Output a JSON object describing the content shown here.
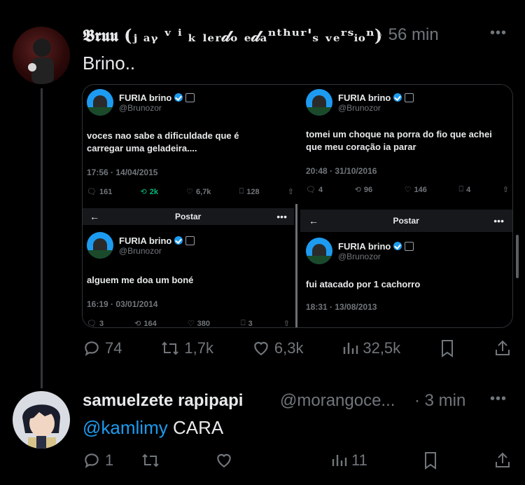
{
  "post1": {
    "author_name": "𝕭𝖗𝖚𝖚 (ⱼ ₐᵧ ᵛ ⁱ ₖ ₗₑᵣ𝒹ₒ ₑ𝒹ₐⁿᵗʰᵘʳ'ₛ ᵥₑʳˢᵢₒⁿ)",
    "time": "· 56 min",
    "text": "Brino..",
    "stats": {
      "replies": "74",
      "retweets": "1,7k",
      "likes": "6,3k",
      "views": "32,5k"
    }
  },
  "media": {
    "cells": [
      {
        "name": "FURIA brino",
        "handle": "@Brunozor",
        "text": "voces nao sabe a dificuldade que é carregar uma geladeira....",
        "date": "17:56 · 14/04/2015",
        "replies": "161",
        "retweets": "2k",
        "likes": "6,7k",
        "bookmarks": "128"
      },
      {
        "name": "FURIA brino",
        "handle": "@Brunozor",
        "text": "tomei um choque na porra do fio que achei que meu coração ia parar",
        "date": "20:48 · 31/10/2016",
        "replies": "4",
        "retweets": "96",
        "likes": "146",
        "bookmarks": "4"
      },
      {
        "bar_title": "Postar",
        "name": "FURIA brino",
        "handle": "@Brunozor",
        "text": "alguem me doa um boné",
        "date": "16:19 · 03/01/2014",
        "replies": "3",
        "retweets": "164",
        "likes": "380",
        "bookmarks": "3"
      },
      {
        "bar_title": "Postar",
        "name": "FURIA brino",
        "handle": "@Brunozor",
        "text": "fui atacado por 1 cachorro",
        "date": "18:31 · 13/08/2013"
      }
    ]
  },
  "post2": {
    "author_name": "samuelzete rapipapi",
    "handle": "@morangoce...",
    "time": "· 3 min",
    "mention": "@kamlimy",
    "text": "CARA",
    "stats": {
      "replies": "1",
      "views": "11"
    }
  },
  "colors": {
    "accent": "#1d9bf0",
    "retweet_green": "#00ba7c",
    "muted": "#71767b"
  }
}
